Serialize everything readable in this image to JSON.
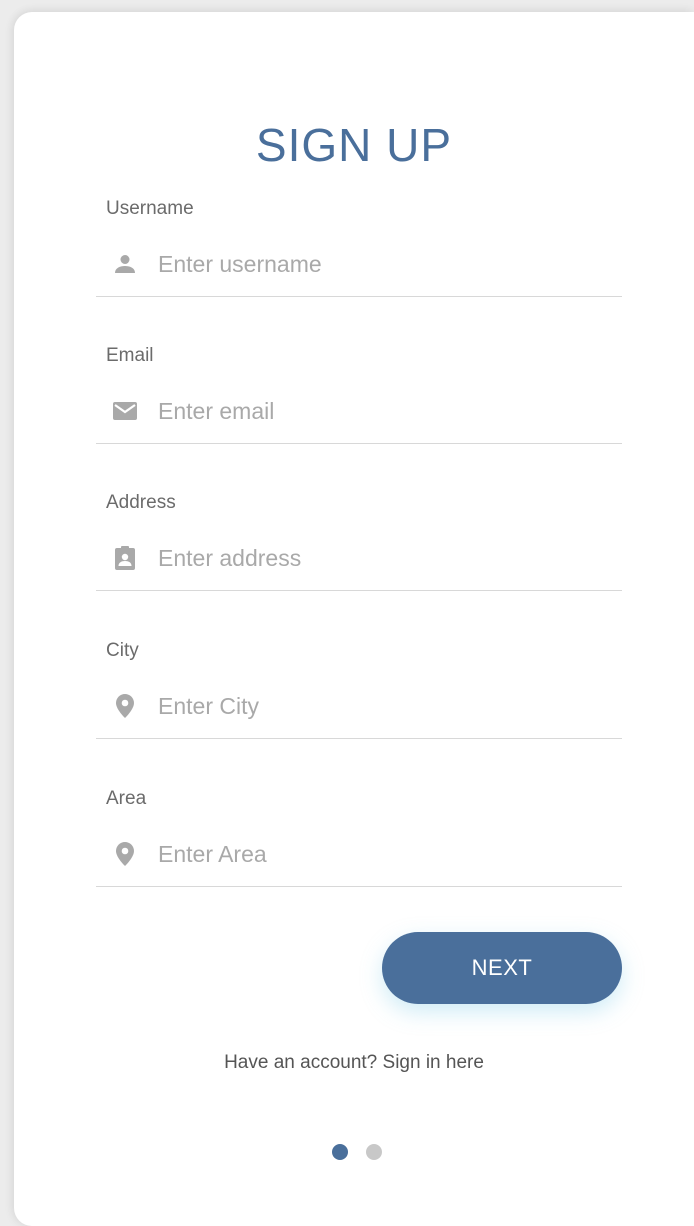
{
  "form": {
    "title": "SIGN UP",
    "fields": [
      {
        "label": "Username",
        "placeholder": "Enter username",
        "value": "",
        "icon": "person-icon"
      },
      {
        "label": "Email",
        "placeholder": "Enter email",
        "value": "",
        "icon": "mail-icon"
      },
      {
        "label": "Address",
        "placeholder": "Enter address",
        "value": "",
        "icon": "contact-card-icon"
      },
      {
        "label": "City",
        "placeholder": "Enter City",
        "value": "",
        "icon": "location-pin-icon"
      },
      {
        "label": "Area",
        "placeholder": "Enter Area",
        "value": "",
        "icon": "location-pin-icon"
      }
    ],
    "next_label": "NEXT",
    "signin_text": "Have an account? Sign in here"
  },
  "pager": {
    "total": 2,
    "current": 1
  },
  "colors": {
    "accent": "#4a6f9b",
    "icon": "#a9a9a9",
    "divider": "#d8d8d8",
    "inactive_dot": "#c8c8c8"
  }
}
